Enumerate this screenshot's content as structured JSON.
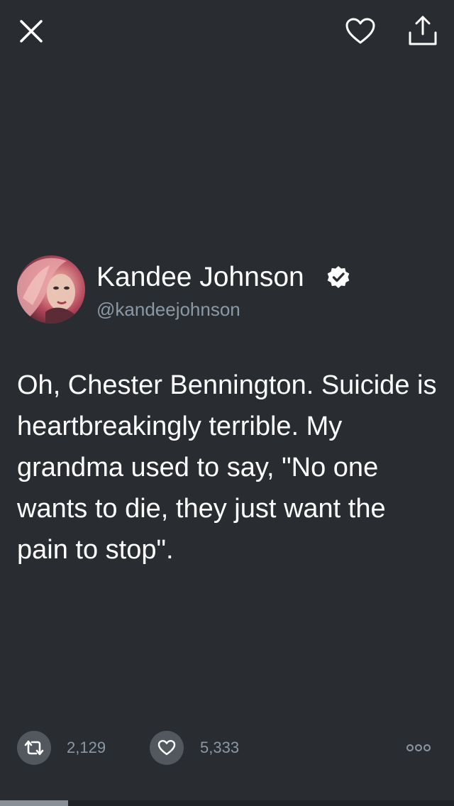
{
  "topbar": {
    "close_icon": "close-icon",
    "like_icon": "heart-outline-icon",
    "share_icon": "share-icon"
  },
  "tweet": {
    "author_name": "Kandee Johnson",
    "author_handle": "@kandeejohnson",
    "verified": true,
    "text": "Oh, Chester Bennington. Suicide is heartbreakingly terrible. My grandma used to say, \"No one wants to die, they just want the pain to stop\".",
    "retweet_count": "2,129",
    "like_count": "5,333"
  },
  "actions": {
    "retweet_icon": "retweet-icon",
    "like_icon": "heart-outline-icon",
    "more_icon": "more-icon"
  },
  "progress": {
    "value": 0.15
  },
  "colors": {
    "background": "#292d31",
    "secondary_text": "#8b98a5",
    "action_circle": "#53585e"
  }
}
